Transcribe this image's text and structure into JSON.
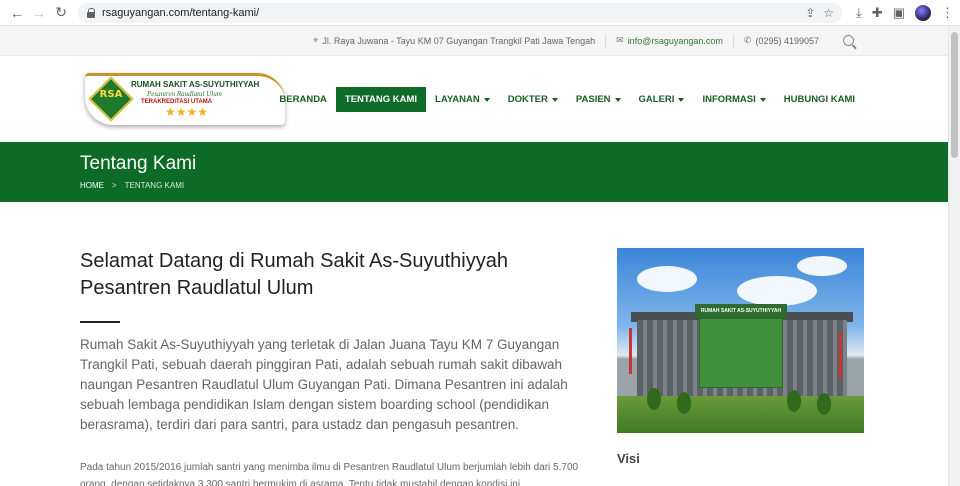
{
  "browser": {
    "url": "rsaguyangan.com/tentang-kami/"
  },
  "topbar": {
    "address": "Jl. Raya Juwana - Tayu KM 07 Guyangan Trangkil Pati Jawa Tengah",
    "email": "info@rsaguyangan.com",
    "phone": "(0295) 4199057"
  },
  "logo": {
    "line1": "RUMAH SAKIT AS-SUYUTHIYYAH",
    "line2": "Pesantren Raudlatul Ulum",
    "line3": "TERAKREDITASI UTAMA",
    "badge": "RSA",
    "stars": "★★★★"
  },
  "menu": {
    "items": [
      {
        "label": "BERANDA"
      },
      {
        "label": "TENTANG KAMI"
      },
      {
        "label": "LAYANAN"
      },
      {
        "label": "DOKTER"
      },
      {
        "label": "PASIEN"
      },
      {
        "label": "GALERI"
      },
      {
        "label": "INFORMASI"
      },
      {
        "label": "HUBUNGI KAMI"
      }
    ]
  },
  "band": {
    "title": "Tentang Kami",
    "crumb_home": "HOME",
    "crumb_sep": ">",
    "crumb_current": "TENTANG KAMI"
  },
  "content": {
    "heading": "Selamat Datang di Rumah Sakit As-Suyuthiyyah Pesantren Raudlatul Ulum",
    "lead": "Rumah Sakit As-Suyuthiyyah yang terletak di Jalan Juana Tayu KM 7 Guyangan Trangkil Pati, sebuah daerah pinggiran Pati, adalah sebuah rumah sakit dibawah naungan Pesantren Raudlatul Ulum Guyangan Pati. Dimana Pesantren ini adalah sebuah lembaga pendidikan Islam dengan sistem boarding school (pendidikan berasrama), terdiri dari para santri, para ustadz dan pengasuh pesantren.",
    "para": "Pada tahun 2015/2016 jumlah santri yang menimba ilmu di Pesantren Raudlatul Ulum berjumlah lebih dari 5.700 orang, dengan setidaknya 3.300 santri bermukim di asrama. Tentu tidak mustahil dengan kondisi ini",
    "photo_sign": "RUMAH SAKIT AS-SUYUTHIYYAH",
    "side_heading": "Visi"
  }
}
